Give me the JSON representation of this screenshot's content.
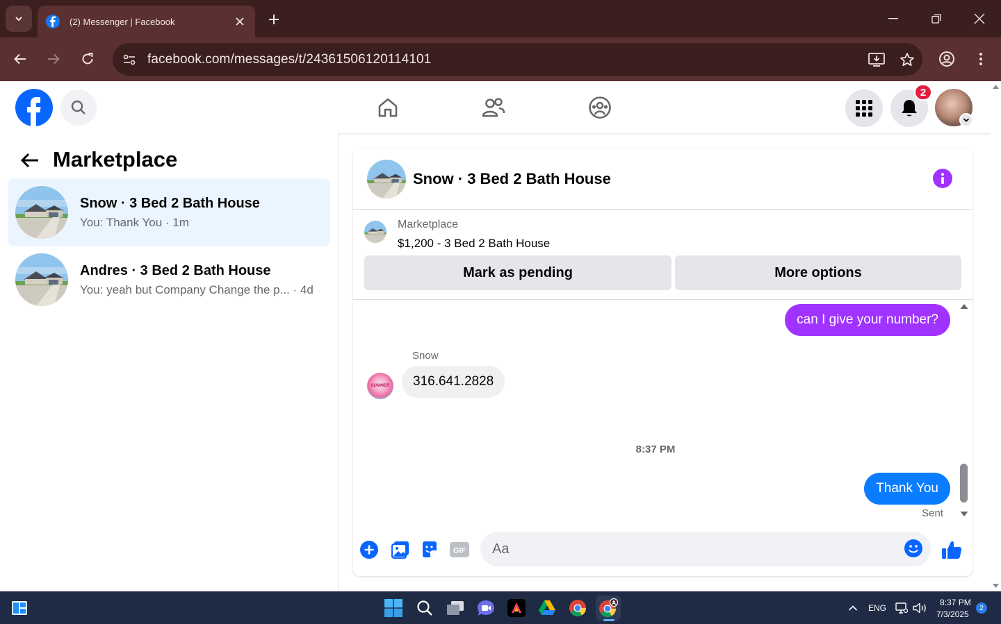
{
  "browser": {
    "tab_title": "(2) Messenger | Facebook",
    "url": "facebook.com/messages/t/24361506120114101"
  },
  "fb_header": {
    "notification_count": "2"
  },
  "left_panel": {
    "title": "Marketplace",
    "conversations": [
      {
        "name": "Snow · 3 Bed 2 Bath House",
        "preview": "You: Thank You · 1m",
        "active": true
      },
      {
        "name": "Andres · 3 Bed 2 Bath House",
        "preview": "You: yeah but Company Change the p... · 4d",
        "active": false
      }
    ]
  },
  "chat": {
    "title": "Snow · 3 Bed 2 Bath House",
    "listing": {
      "source": "Marketplace",
      "price_title": "$1,200 - 3 Bed 2 Bath House",
      "mark_pending_label": "Mark as pending",
      "more_options_label": "More options"
    },
    "messages": {
      "outgoing_1": "can I give your number?",
      "sender_name": "Snow",
      "incoming_1": "316.641.2828",
      "timestamp": "8:37 PM",
      "outgoing_2": "Thank You",
      "status": "Sent"
    },
    "composer": {
      "placeholder": "Aa"
    }
  },
  "taskbar": {
    "language": "ENG",
    "time": "8:37 PM",
    "date": "7/3/2025",
    "notification_count": "2"
  },
  "colors": {
    "accent_purple": "#a033ff",
    "accent_blue": "#0a7cff",
    "fb_blue": "#0866ff"
  }
}
